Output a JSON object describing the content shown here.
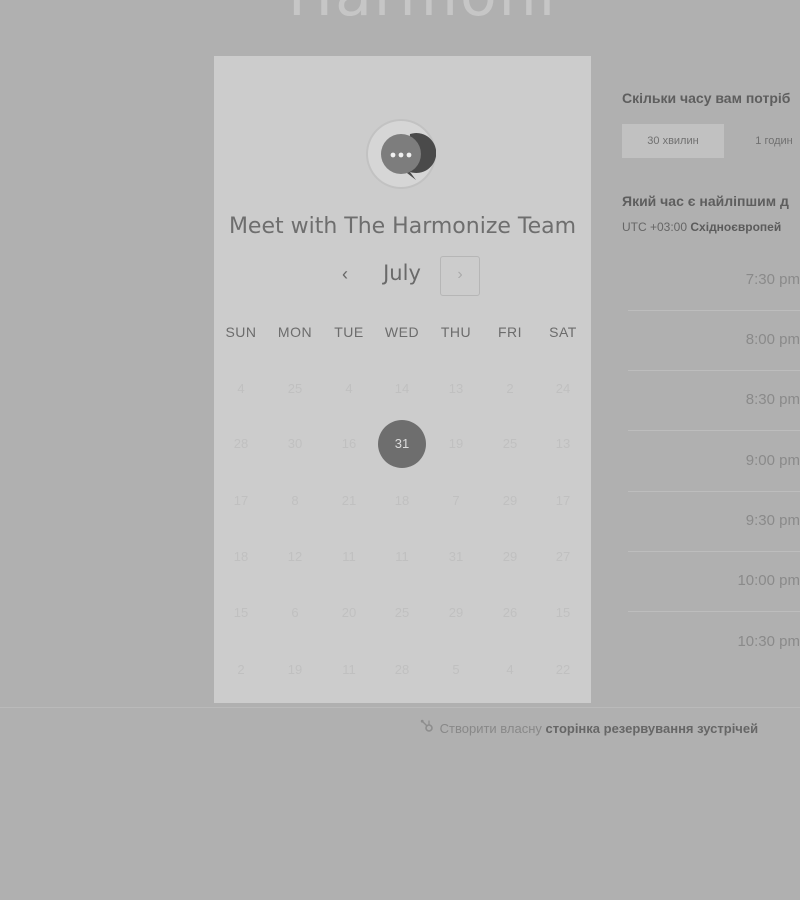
{
  "header": {
    "logo_text": "Harmoni"
  },
  "calendar": {
    "title": "Meet with The Harmonize Team",
    "month": "July",
    "prev_icon": "‹",
    "next_icon": "›",
    "weekdays": [
      "SUN",
      "MON",
      "TUE",
      "WED",
      "THU",
      "FRI",
      "SAT"
    ],
    "weeks": [
      [
        "4",
        "25",
        "4",
        "14",
        "13",
        "2",
        "24"
      ],
      [
        "28",
        "30",
        "16",
        "31",
        "19",
        "25",
        "13"
      ],
      [
        "17",
        "8",
        "21",
        "18",
        "7",
        "29",
        "17"
      ],
      [
        "18",
        "12",
        "11",
        "11",
        "31",
        "29",
        "27"
      ],
      [
        "15",
        "6",
        "20",
        "25",
        "29",
        "26",
        "15"
      ],
      [
        "2",
        "19",
        "11",
        "28",
        "5",
        "4",
        "22"
      ]
    ],
    "selected_day": "31",
    "selected_color": "#6e6e6e"
  },
  "duration": {
    "question": "Скільки часу вам потріб",
    "options": [
      "30 хвилин",
      "1 годин"
    ],
    "selected": "30 хвилин"
  },
  "time": {
    "question": "Який час є найліпшим д",
    "timezone_offset": "UTC +03:00",
    "timezone_name": "Східноєвропей",
    "slots": [
      "7:30 pm",
      "8:00 pm",
      "8:30 pm",
      "9:00 pm",
      "9:30 pm",
      "10:00 pm",
      "10:30 pm"
    ]
  },
  "footer": {
    "icon": "sprocket-icon",
    "text": "Створити власну",
    "link": "сторінка резервування зустрічей"
  }
}
